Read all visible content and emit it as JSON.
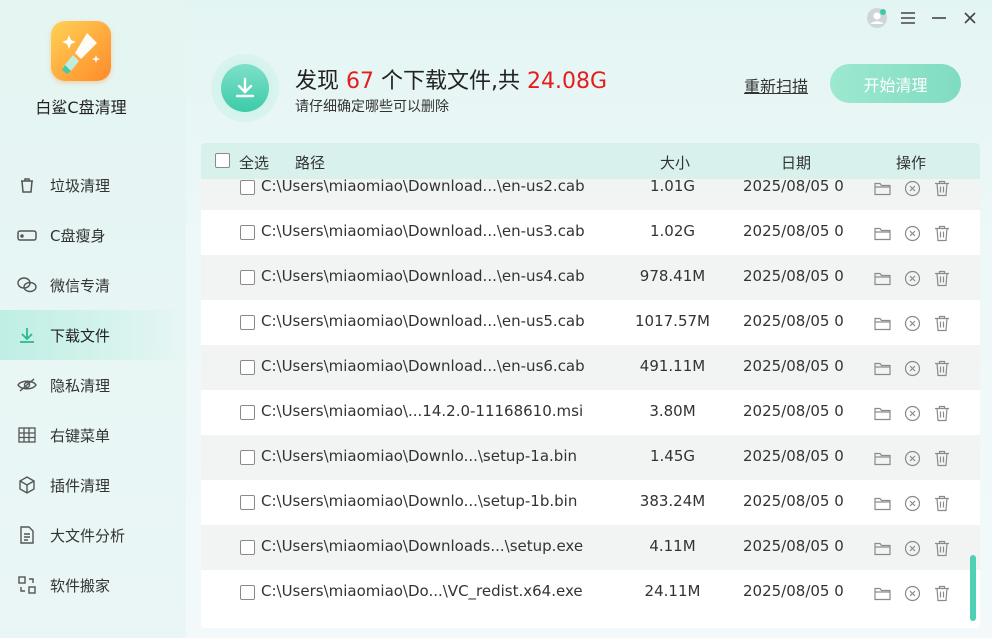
{
  "app": {
    "name": "白鲨C盘清理"
  },
  "sidebar": {
    "items": [
      {
        "label": "垃圾清理",
        "icon": "trash-icon",
        "active": false
      },
      {
        "label": "C盘瘦身",
        "icon": "disk-icon",
        "active": false
      },
      {
        "label": "微信专清",
        "icon": "wechat-icon",
        "active": false
      },
      {
        "label": "下载文件",
        "icon": "download-icon",
        "active": true
      },
      {
        "label": "隐私清理",
        "icon": "eye-off-icon",
        "active": false
      },
      {
        "label": "右键菜单",
        "icon": "grid-icon",
        "active": false
      },
      {
        "label": "插件清理",
        "icon": "cube-icon",
        "active": false
      },
      {
        "label": "大文件分析",
        "icon": "file-icon",
        "active": false
      },
      {
        "label": "软件搬家",
        "icon": "move-icon",
        "active": false
      }
    ]
  },
  "summary": {
    "prefix": "发现 ",
    "count": "67",
    "middle": " 个下载文件,共 ",
    "total": "24.08G",
    "sub": "请仔细确定哪些可以删除",
    "rescan": "重新扫描",
    "start": "开始清理"
  },
  "colors": {
    "accent": "#3ccba8",
    "highlight": "#e51c1c",
    "header_row": "#d8f1ec"
  },
  "table": {
    "select_all": "全选",
    "columns": {
      "path": "路径",
      "size": "大小",
      "date": "日期",
      "ops": "操作"
    },
    "rows": [
      {
        "path": "C:\\Users\\miaomiao\\Download...\\en-us2.cab",
        "size": "1.01G",
        "date": "2025/08/05 0"
      },
      {
        "path": "C:\\Users\\miaomiao\\Download...\\en-us3.cab",
        "size": "1.02G",
        "date": "2025/08/05 0"
      },
      {
        "path": "C:\\Users\\miaomiao\\Download...\\en-us4.cab",
        "size": "978.41M",
        "date": "2025/08/05 0"
      },
      {
        "path": "C:\\Users\\miaomiao\\Download...\\en-us5.cab",
        "size": "1017.57M",
        "date": "2025/08/05 0"
      },
      {
        "path": "C:\\Users\\miaomiao\\Download...\\en-us6.cab",
        "size": "491.11M",
        "date": "2025/08/05 0"
      },
      {
        "path": "C:\\Users\\miaomiao\\...14.2.0-11168610.msi",
        "size": "3.80M",
        "date": "2025/08/05 0"
      },
      {
        "path": "C:\\Users\\miaomiao\\Downlo...\\setup-1a.bin",
        "size": "1.45G",
        "date": "2025/08/05 0"
      },
      {
        "path": "C:\\Users\\miaomiao\\Downlo...\\setup-1b.bin",
        "size": "383.24M",
        "date": "2025/08/05 0"
      },
      {
        "path": "C:\\Users\\miaomiao\\Downloads...\\setup.exe",
        "size": "4.11M",
        "date": "2025/08/05 0"
      },
      {
        "path": "C:\\Users\\miaomiao\\Do...\\VC_redist.x64.exe",
        "size": "24.11M",
        "date": "2025/08/05 0"
      }
    ]
  }
}
